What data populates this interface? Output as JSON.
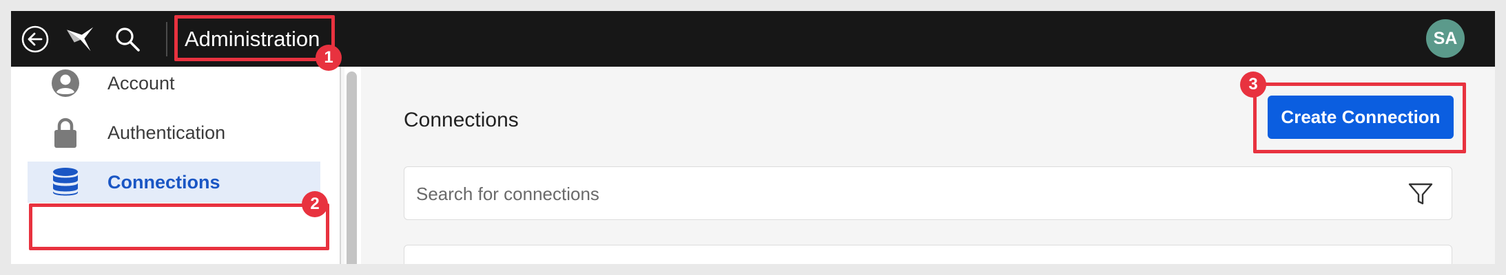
{
  "topbar": {
    "title": "Administration",
    "avatar_initials": "SA",
    "icons": {
      "back": "back-arrow-icon",
      "logo": "app-logo-icon",
      "search": "search-icon"
    }
  },
  "sidebar": {
    "items": [
      {
        "label": "Account",
        "icon": "user-circle-icon",
        "active": false
      },
      {
        "label": "Authentication",
        "icon": "lock-icon",
        "active": false
      },
      {
        "label": "Connections",
        "icon": "database-icon",
        "active": true
      }
    ]
  },
  "main": {
    "title": "Connections",
    "create_button": "Create Connection",
    "search_placeholder": "Search for connections",
    "filter_icon": "filter-icon"
  },
  "annotations": [
    "1",
    "2",
    "3"
  ],
  "colors": {
    "topbar_bg": "#171717",
    "accent": "#0b5ee0",
    "annotation_red": "#e8323f",
    "avatar_bg": "#5b9a8b",
    "active_item_bg": "#e4ecf9"
  }
}
